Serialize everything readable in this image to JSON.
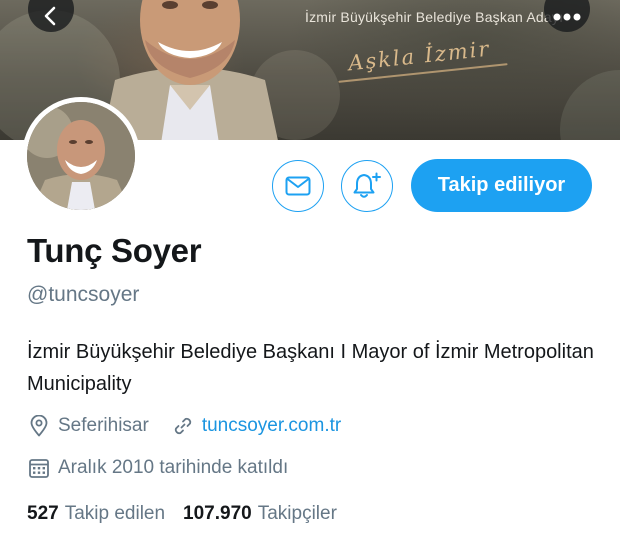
{
  "banner": {
    "title": "İzmir Büyükşehir Belediye Başkan Adayı",
    "script_text": "Aşkla İzmir"
  },
  "nav": {
    "back_icon": "chevron-left-icon",
    "more_icon": "more-horizontal-icon"
  },
  "actions": {
    "message_icon": "envelope-icon",
    "notify_icon": "bell-plus-icon",
    "follow_label": "Takip ediliyor"
  },
  "profile": {
    "name": "Tunç Soyer",
    "handle": "@tuncsoyer",
    "bio": "İzmir Büyükşehir Belediye Başkanı I Mayor of İzmir Metropolitan Municipality",
    "location": "Seferihisar",
    "website": "tuncsoyer.com.tr",
    "joined": "Aralık 2010 tarihinde katıldı"
  },
  "stats": {
    "following_count": "527",
    "following_label": "Takip edilen",
    "followers_count": "107.970",
    "followers_label": "Takipçiler"
  },
  "colors": {
    "accent": "#1da1f2",
    "link": "#1b95e0",
    "secondary_text": "#657786",
    "primary_text": "#14171a"
  }
}
